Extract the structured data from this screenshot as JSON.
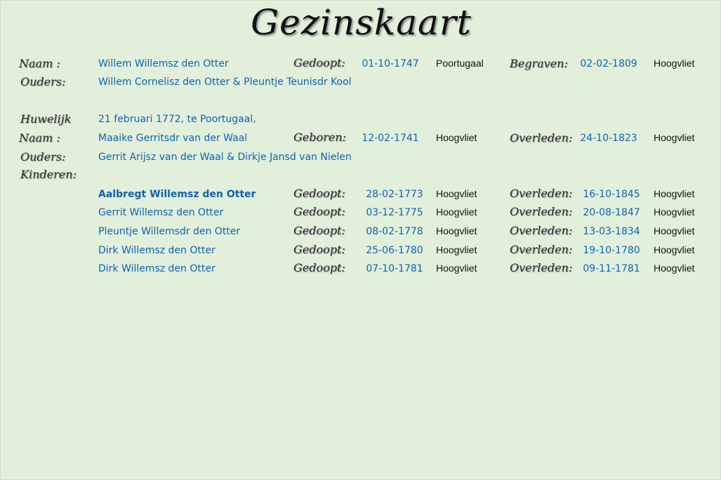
{
  "title": "Gezinskaart",
  "person": {
    "label_name": "Naam :",
    "name": "Willem Willemsz den Otter",
    "label_event1": "Gedoopt:",
    "date1": "01-10-1747",
    "place1": "Poortugaal",
    "label_event2": "Begraven:",
    "date2": "02-02-1809",
    "place2": "Hoogvliet",
    "label_parents": "Ouders:",
    "parents": "Willem Cornelisz den Otter & Pleuntje Teunisdr Kool"
  },
  "marriage": {
    "label": "Huwelijk",
    "text": "21 februari 1772, te Poortugaal,"
  },
  "spouse": {
    "label_name": "Naam :",
    "name": "Maaike Gerritsdr van der Waal",
    "label_event1": "Geboren:",
    "date1": "12-02-1741",
    "place1": "Hoogvliet",
    "label_event2": "Overleden:",
    "date2": "24-10-1823",
    "place2": "Hoogvliet",
    "label_parents": "Ouders:",
    "parents": "Gerrit Arijsz van der Waal & Dirkje Jansd van Nielen"
  },
  "children_label": "Kinderen:",
  "children": [
    {
      "name": "Aalbregt Willemsz den Otter",
      "label_event1": "Gedoopt:",
      "date1": "28-02-1773",
      "place1": "Hoogvliet",
      "label_event2": "Overleden:",
      "date2": "16-10-1845",
      "place2": "Hoogvliet"
    },
    {
      "name": "Gerrit Willemsz den Otter",
      "label_event1": "Gedoopt:",
      "date1": "03-12-1775",
      "place1": "Hoogvliet",
      "label_event2": "Overleden:",
      "date2": "20-08-1847",
      "place2": "Hoogvliet"
    },
    {
      "name": "Pleuntje Willemsdr den Otter",
      "label_event1": "Gedoopt:",
      "date1": "08-02-1778",
      "place1": "Hoogvliet",
      "label_event2": "Overleden:",
      "date2": "13-03-1834",
      "place2": "Hoogvliet"
    },
    {
      "name": "Dirk Willemsz den Otter",
      "label_event1": "Gedoopt:",
      "date1": "25-06-1780",
      "place1": "Hoogvliet",
      "label_event2": "Overleden:",
      "date2": "19-10-1780",
      "place2": "Hoogvliet"
    },
    {
      "name": "Dirk Willemsz den Otter",
      "label_event1": "Gedoopt:",
      "date1": "07-10-1781",
      "place1": "Hoogvliet",
      "label_event2": "Overleden:",
      "date2": "09-11-1781",
      "place2": "Hoogvliet"
    }
  ]
}
